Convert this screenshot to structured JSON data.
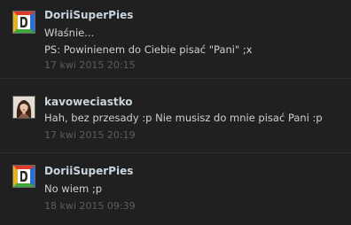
{
  "messages": [
    {
      "author": "DoriiSuperPies",
      "avatar_icon": "d-logo-avatar-icon",
      "lines": [
        "Właśnie...",
        "PS: Powinienem do Ciebie pisać \"Pani\" ;x"
      ],
      "time": "17 kwi 2015 20:15"
    },
    {
      "author": "kavoweciastko",
      "avatar_icon": "user-photo-avatar",
      "lines": [
        "Hah, bez przesady :p Nie musisz do mnie pisać Pani :p"
      ],
      "time": "17 kwi 2015 20:19"
    },
    {
      "author": "DoriiSuperPies",
      "avatar_icon": "d-logo-avatar-icon",
      "lines": [
        "No wiem ;p"
      ],
      "time": "18 kwi 2015 09:39"
    }
  ],
  "colors": {
    "background": "#202020",
    "author": "#c8d3db",
    "text": "#d0d0d0",
    "timestamp": "#5c5c5c",
    "divider": "#2c2c2c"
  }
}
